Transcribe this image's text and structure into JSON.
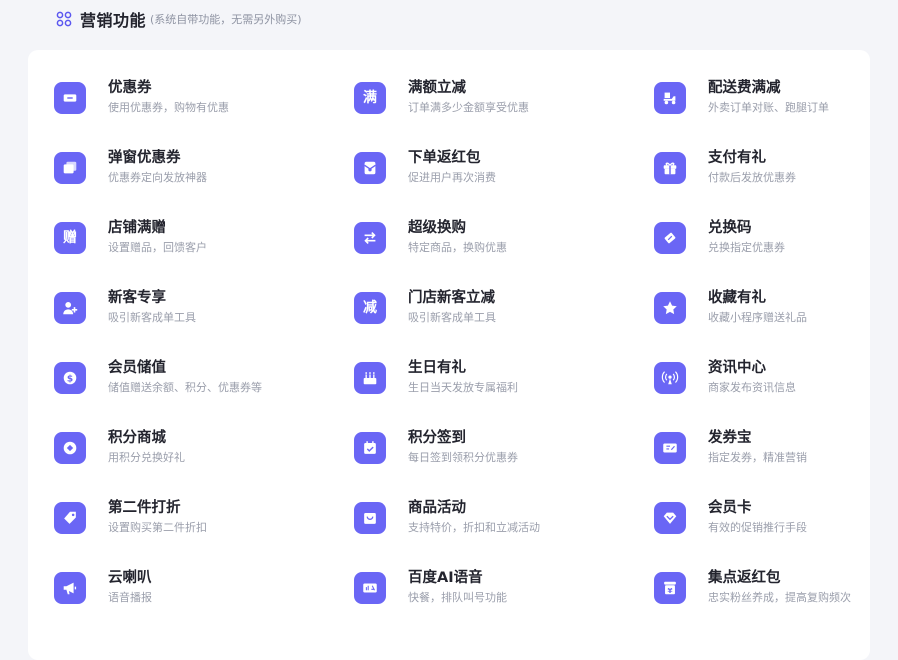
{
  "header": {
    "title": "营销功能",
    "note": "(系统自带功能，无需另外购买)",
    "icon": "grid-icon"
  },
  "colors": {
    "accent": "#6a66f5",
    "background": "#f4f5f9",
    "card": "#ffffff",
    "title_text": "#23242e",
    "desc_text": "#9a9eab"
  },
  "features": [
    {
      "icon": "ticket-icon",
      "title": "优惠券",
      "desc": "使用优惠券，购物有优惠"
    },
    {
      "icon": "man-char-icon",
      "glyph": "满",
      "title": "满额立减",
      "desc": "订单满多少金额享受优惠"
    },
    {
      "icon": "delivery-scooter-icon",
      "title": "配送费满减",
      "desc": "外卖订单对账、跑腿订单"
    },
    {
      "icon": "popup-window-icon",
      "title": "弹窗优惠券",
      "desc": "优惠券定向发放神器"
    },
    {
      "icon": "red-envelope-icon",
      "title": "下单返红包",
      "desc": "促进用户再次消费"
    },
    {
      "icon": "gift-box-icon",
      "title": "支付有礼",
      "desc": "付款后发放优惠券"
    },
    {
      "icon": "zeng-char-icon",
      "glyph": "赠",
      "title": "店铺满赠",
      "desc": "设置赠品，回馈客户"
    },
    {
      "icon": "swap-arrows-icon",
      "title": "超级换购",
      "desc": "特定商品，换购优惠"
    },
    {
      "icon": "coupon-tag-icon",
      "title": "兑换码",
      "desc": "兑换指定优惠券"
    },
    {
      "icon": "user-add-icon",
      "title": "新客专享",
      "desc": "吸引新客成单工具"
    },
    {
      "icon": "jian-char-icon",
      "glyph": "减",
      "title": "门店新客立减",
      "desc": "吸引新客成单工具"
    },
    {
      "icon": "star-icon",
      "title": "收藏有礼",
      "desc": "收藏小程序赠送礼品"
    },
    {
      "icon": "dollar-coin-icon",
      "title": "会员储值",
      "desc": "储值赠送余额、积分、优惠券等"
    },
    {
      "icon": "birthday-cake-icon",
      "title": "生日有礼",
      "desc": "生日当天发放专属福利"
    },
    {
      "icon": "broadcast-icon",
      "title": "资讯中心",
      "desc": "商家发布资讯信息"
    },
    {
      "icon": "points-coin-icon",
      "title": "积分商城",
      "desc": "用积分兑换好礼"
    },
    {
      "icon": "calendar-check-icon",
      "title": "积分签到",
      "desc": "每日签到领积分优惠券"
    },
    {
      "icon": "voucher-icon",
      "title": "发券宝",
      "desc": "指定发券，精准营销"
    },
    {
      "icon": "price-tag-icon",
      "title": "第二件打折",
      "desc": "设置购买第二件折扣"
    },
    {
      "icon": "shopping-bag-icon",
      "title": "商品活动",
      "desc": "支持特价，折扣和立减活动"
    },
    {
      "icon": "diamond-icon",
      "title": "会员卡",
      "desc": "有效的促销推行手段"
    },
    {
      "icon": "megaphone-icon",
      "title": "云喇叭",
      "desc": "语音播报"
    },
    {
      "icon": "ai-voice-icon",
      "title": "百度AI语音",
      "desc": "快餐，排队叫号功能"
    },
    {
      "icon": "yen-stamp-icon",
      "title": "集点返红包",
      "desc": "忠实粉丝养成，提高复购频次"
    }
  ]
}
